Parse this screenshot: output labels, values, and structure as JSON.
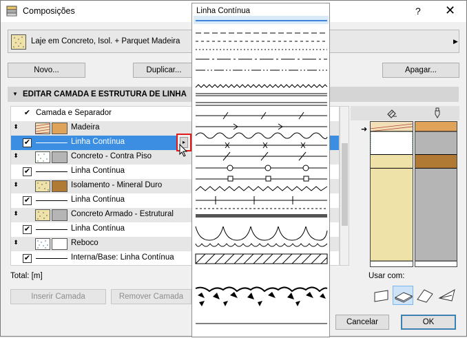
{
  "window": {
    "title": "Composições",
    "help": "?",
    "close": "✕"
  },
  "composite": {
    "name": "Laje em Concreto, Isol. + Parquet Madeira"
  },
  "buttons": {
    "new": "Novo...",
    "duplicate": "Duplicar...",
    "delete": "Apagar...",
    "insert_layer": "Inserir Camada",
    "remove_layer": "Remover Camada",
    "cancel": "Cancelar",
    "ok": "OK"
  },
  "section": {
    "title": "EDITAR CAMADA E ESTRUTURA DE LINHA"
  },
  "layers": {
    "header": "Camada e Separador",
    "rows": [
      {
        "label": "Madeira",
        "kind": "layer"
      },
      {
        "label": "Linha Contínua",
        "kind": "line",
        "selected": true
      },
      {
        "label": "Concreto - Contra Piso",
        "kind": "layer"
      },
      {
        "label": "Linha Contínua",
        "kind": "line"
      },
      {
        "label": "Isolamento - Mineral Duro",
        "kind": "layer"
      },
      {
        "label": "Linha Contínua",
        "kind": "line"
      },
      {
        "label": "Concreto Armado - Estrutural",
        "kind": "layer"
      },
      {
        "label": "Linha Contínua",
        "kind": "line"
      },
      {
        "label": "Reboco",
        "kind": "layer"
      },
      {
        "label": "Interna/Base: Linha Contínua",
        "kind": "line"
      }
    ]
  },
  "total": {
    "label": "Total: [m]"
  },
  "usage": {
    "label": "Usar com:"
  },
  "popup": {
    "title": "Linha Contínua"
  },
  "colors": {
    "selection": "#3b8ee2",
    "highlight_border": "#e01a1a",
    "wood_orange": "#e0a35a",
    "concrete_gray": "#b5b5b5",
    "insulation_brown": "#b07a35",
    "sand": "#efe2a8"
  },
  "icons": {
    "app": "composites-icon",
    "expand": "triangle-down-icon",
    "drag": "drag-handle-icon",
    "fill_header": "fill-icon",
    "pen_header": "pen-icon"
  }
}
